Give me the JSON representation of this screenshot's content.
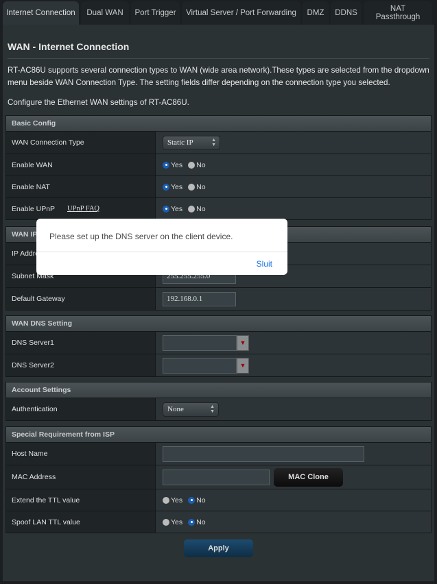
{
  "tabs": [
    {
      "label": "Internet Connection",
      "active": true
    },
    {
      "label": "Dual WAN"
    },
    {
      "label": "Port Trigger"
    },
    {
      "label": "Virtual Server / Port Forwarding"
    },
    {
      "label": "DMZ"
    },
    {
      "label": "DDNS"
    },
    {
      "label": "NAT Passthrough"
    }
  ],
  "title": "WAN - Internet Connection",
  "description": "RT-AC86U supports several connection types to WAN (wide area network).These types are selected from the dropdown menu beside WAN Connection Type. The setting fields differ depending on the connection type you selected.",
  "description2": "Configure the Ethernet WAN settings of RT-AC86U.",
  "radio": {
    "yes": "Yes",
    "no": "No"
  },
  "basic": {
    "header": "Basic Config",
    "wan_type_label": "WAN Connection Type",
    "wan_type_value": "Static IP",
    "enable_wan": "Enable WAN",
    "enable_nat": "Enable NAT",
    "enable_upnp": "Enable UPnP",
    "upnp_faq": "UPnP FAQ"
  },
  "wanip": {
    "header": "WAN IP Setting",
    "ip_label": "IP Address",
    "subnet_label": "Subnet Mask",
    "subnet_value": "255.255.255.0",
    "gateway_label": "Default Gateway",
    "gateway_value": "192.168.0.1"
  },
  "dns": {
    "header": "WAN DNS Setting",
    "dns1": "DNS Server1",
    "dns2": "DNS Server2"
  },
  "account": {
    "header": "Account Settings",
    "auth_label": "Authentication",
    "auth_value": "None"
  },
  "isp": {
    "header": "Special Requirement from ISP",
    "host": "Host Name",
    "mac": "MAC Address",
    "mac_clone": "MAC Clone",
    "ttl": "Extend the TTL value",
    "spoof": "Spoof LAN TTL value"
  },
  "apply": "Apply",
  "modal": {
    "message": "Please set up the DNS server on the client device.",
    "close": "Sluit"
  },
  "colors": {
    "accent": "#1a5fb4",
    "link": "#1a73e8"
  }
}
